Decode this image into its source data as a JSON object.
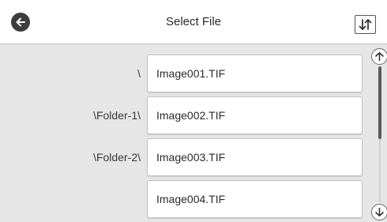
{
  "header": {
    "title": "Select File",
    "back_icon": "arrow-left-icon",
    "sort_icon": "sort-up-down-icon"
  },
  "files": [
    {
      "path": "\\",
      "name": "Image001.TIF"
    },
    {
      "path": "\\Folder-1\\",
      "name": "Image002.TIF"
    },
    {
      "path": "\\Folder-2\\",
      "name": "Image003.TIF"
    },
    {
      "path": "",
      "name": "Image004.TIF"
    }
  ],
  "scrollbar": {
    "up_icon": "arrow-up-icon",
    "down_icon": "arrow-down-icon"
  },
  "colors": {
    "background": "#e6e6e6",
    "header": "#ffffff",
    "back_button": "#3d3d3d",
    "text": "#2b2b2b"
  }
}
